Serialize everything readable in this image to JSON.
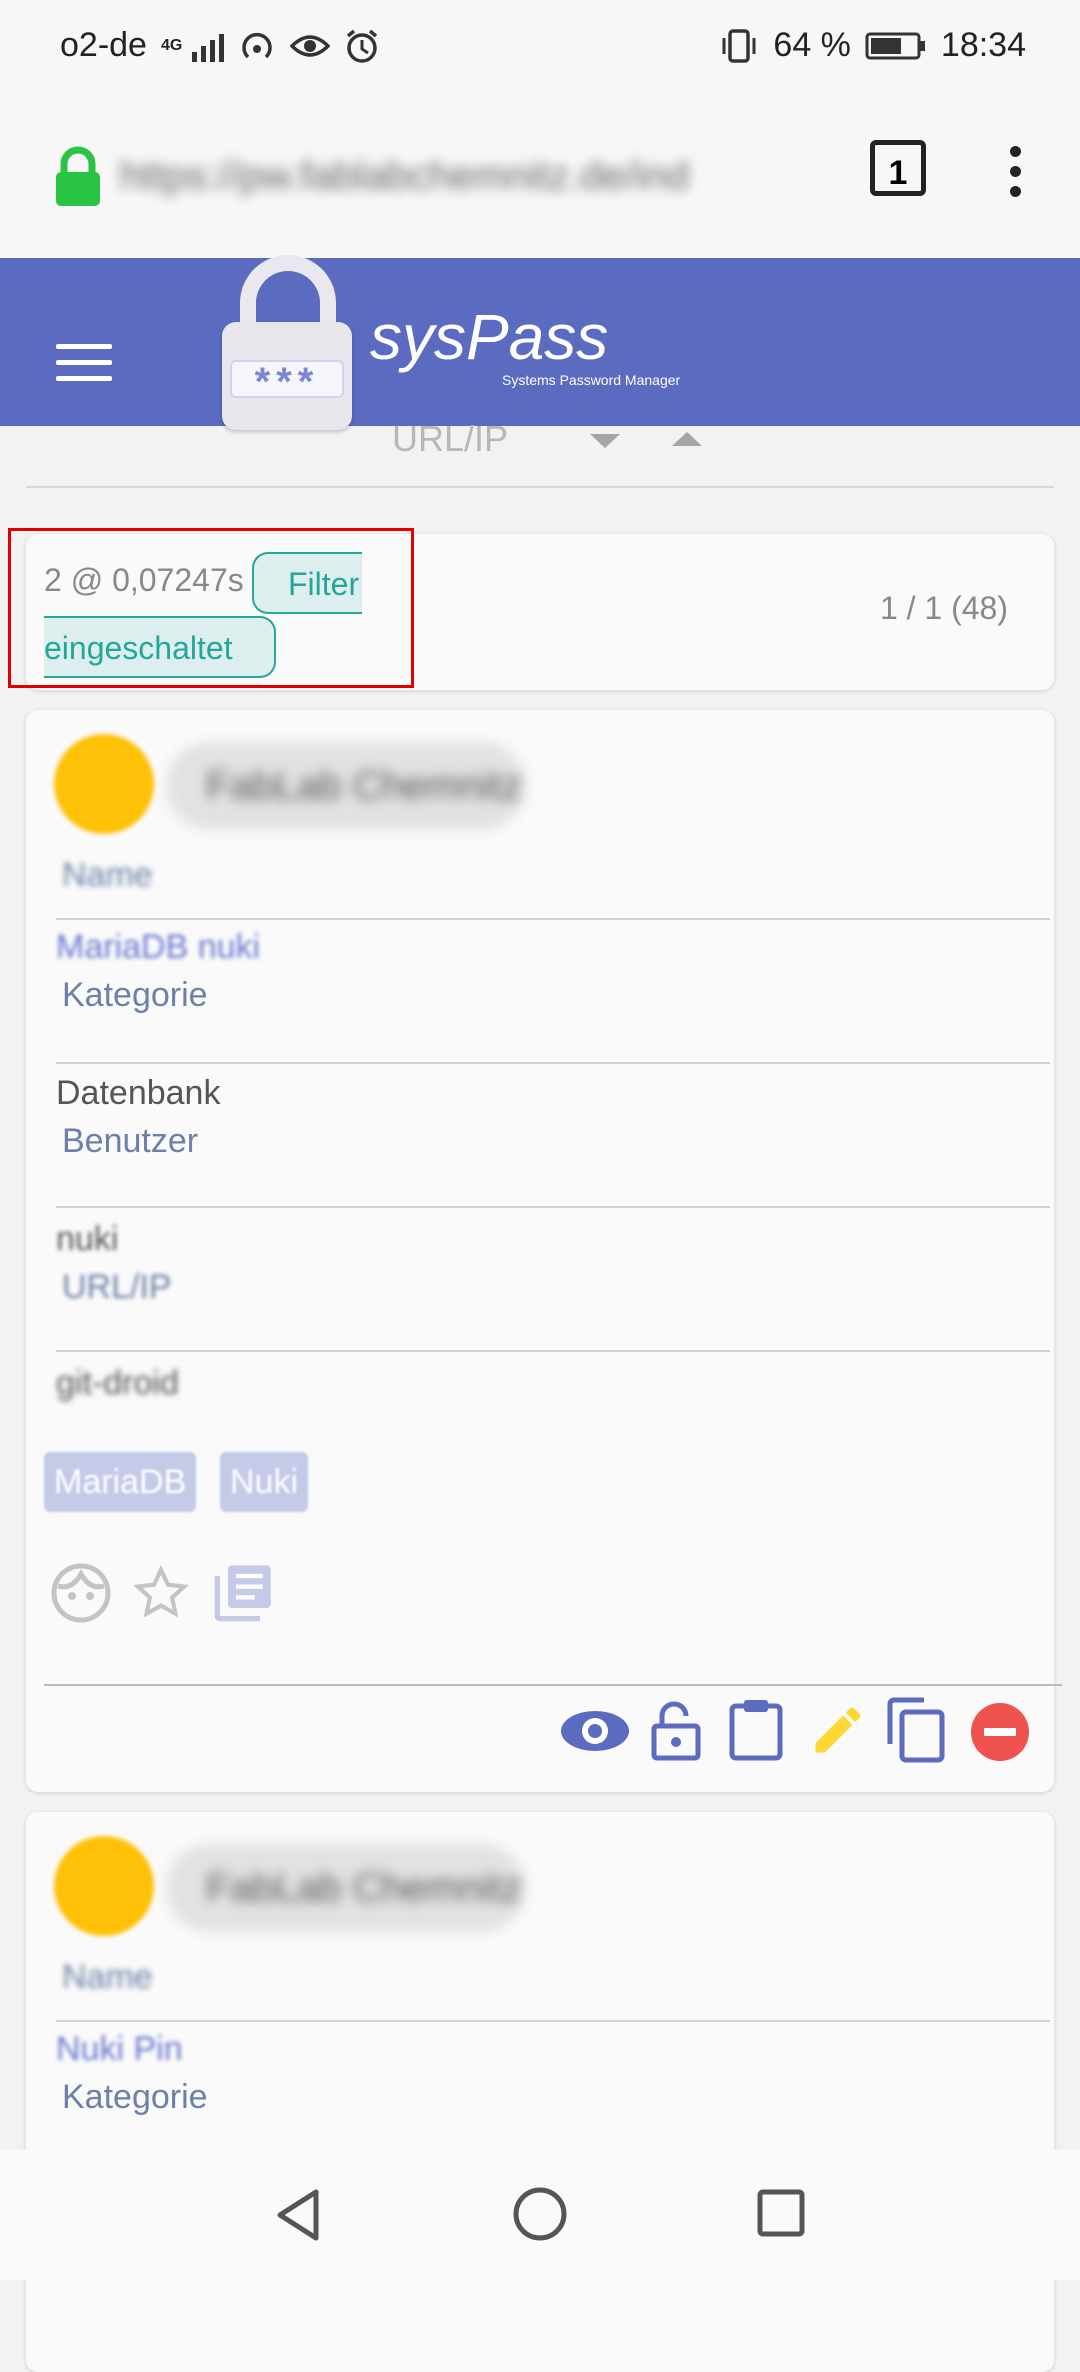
{
  "status_bar": {
    "carrier": "o2-de",
    "network": "4G",
    "battery": "64 %",
    "time": "18:34"
  },
  "browser": {
    "url": "https://pw.fablabchemnitz.de/ind",
    "tab_count": "1"
  },
  "header": {
    "brand": "sysPass",
    "subtitle": "Systems Password Manager",
    "logo_text": "***"
  },
  "sort": {
    "label": "URL/IP"
  },
  "results": {
    "summary": "2 @ 0,07247s",
    "filter_badge_line1": "Filter",
    "filter_badge_line2": "eingeschaltet",
    "pages": "1 / 1 (48)"
  },
  "accounts": [
    {
      "client": "FabLab Chemnitz",
      "name_label": "Name",
      "name": "MariaDB nuki",
      "category_label": "Kategorie",
      "category": "Datenbank",
      "user_label": "Benutzer",
      "user": "nuki",
      "url_label": "URL/IP",
      "url": "git-droid",
      "tags": [
        "MariaDB",
        "Nuki"
      ]
    },
    {
      "client": "FabLab Chemnitz",
      "name_label": "Name",
      "name": "Nuki Pin",
      "category_label": "Kategorie"
    }
  ],
  "colors": {
    "header": "#5b6bc0",
    "accent": "#26a69a",
    "avatar": "#ffc107",
    "tag_bg": "#c5cae9"
  }
}
